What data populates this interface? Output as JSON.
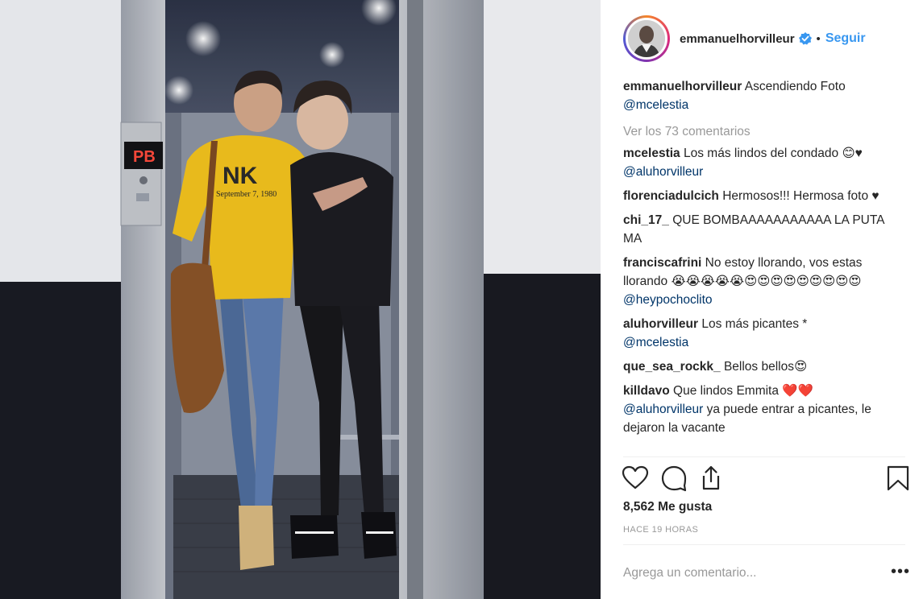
{
  "post": {
    "author": "emmanuelhorvilleur",
    "follow_label": "Seguir",
    "caption_text": "Ascendiendo Foto",
    "caption_mention": "@mcelestia",
    "view_all": "Ver los 73 comentarios",
    "comments": [
      {
        "user": "mcelestia",
        "text": "Los más lindos del condado 😊♥",
        "mention": "@aluhorvilleur",
        "after": ""
      },
      {
        "user": "florenciadulcich",
        "text": "Hermosos!!! Hermosa foto ♥",
        "mention": "",
        "after": ""
      },
      {
        "user": "chi_17_",
        "text": "QUE BOMBAAAAAAAAAAA LA PUTA MA",
        "mention": "",
        "after": ""
      },
      {
        "user": "franciscafrini",
        "text": "No estoy llorando, vos estas llorando 😭😭😭😭😭😍😍😍😍😍😍😍😍😍",
        "mention": "@heypochoclito",
        "after": ""
      },
      {
        "user": "aluhorvilleur",
        "text": "Los más picantes *",
        "mention": "@mcelestia",
        "after": ""
      },
      {
        "user": "que_sea_rockk_",
        "text": "Bellos bellos😍",
        "mention": "",
        "after": ""
      },
      {
        "user": "killdavo",
        "text": "Que lindos Emmita ❤️❤️",
        "mention": "@aluhorvilleur",
        "after": "ya puede entrar a picantes, le dejaron la vacante"
      }
    ],
    "likes": "8,562 Me gusta",
    "time": "HACE 19 HORAS",
    "add_comment_placeholder": "Agrega un comentario...",
    "more_label": "•••"
  },
  "photo": {
    "floor_indicator": "PB",
    "hoodie_text": "September 7, 1980"
  },
  "icons": {
    "verified": "verified-badge-icon",
    "like": "heart-icon",
    "comment": "comment-bubble-icon",
    "share": "share-icon",
    "save": "bookmark-icon"
  },
  "colors": {
    "link_blue": "#3897f0",
    "mention_blue": "#003569",
    "muted_gray": "#999999",
    "verified_blue": "#3897f0"
  }
}
